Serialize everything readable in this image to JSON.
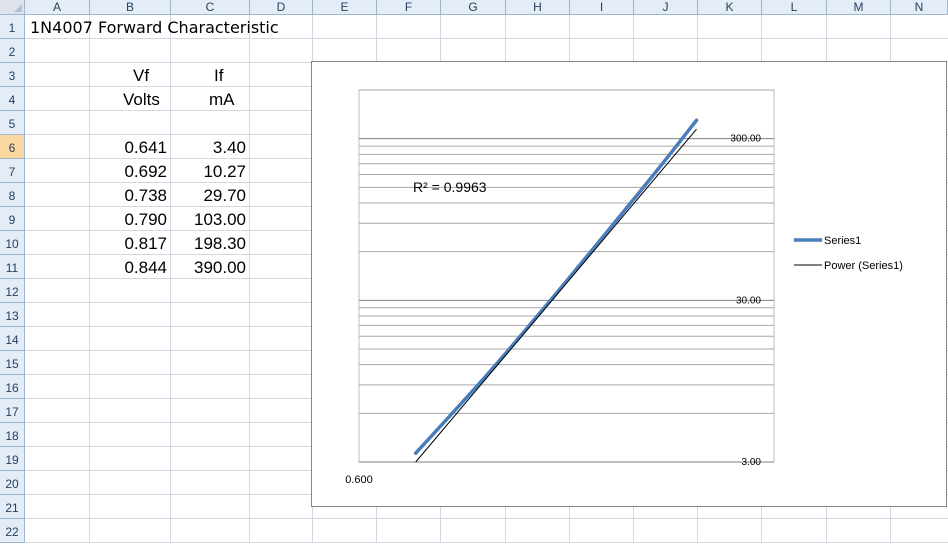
{
  "columns": [
    "A",
    "B",
    "C",
    "D",
    "E",
    "F",
    "G",
    "H",
    "I",
    "J",
    "K",
    "L",
    "M",
    "N"
  ],
  "rows": [
    "1",
    "2",
    "3",
    "4",
    "5",
    "6",
    "7",
    "8",
    "9",
    "10",
    "11",
    "12",
    "13",
    "14",
    "15",
    "16",
    "17",
    "18",
    "19",
    "20",
    "21",
    "22"
  ],
  "active_row": "6",
  "cells": {
    "A1": "1N4007 Forward Characteristic",
    "B3": "Vf",
    "C3": "If",
    "B4": "Volts",
    "C4": "mA",
    "B6": "0.641",
    "C6": "3.40",
    "B7": "0.692",
    "C7": "10.27",
    "B8": "0.738",
    "C8": "29.70",
    "B9": "0.790",
    "C9": "103.00",
    "B10": "0.817",
    "C10": "198.30",
    "B11": "0.844",
    "C11": "390.00"
  },
  "chart_data": {
    "type": "scatter",
    "y_scale": "log",
    "x_tick_labels": [
      "0.600"
    ],
    "y_tick_labels": [
      "3.00",
      "30.00",
      "300.00"
    ],
    "ylim": [
      3,
      600
    ],
    "xlim": [
      0.6,
      0.9
    ],
    "grid": true,
    "legend_position": "right",
    "series": [
      {
        "name": "Series1",
        "color": "#4a7ebb",
        "x": [
          0.641,
          0.692,
          0.738,
          0.79,
          0.817,
          0.844
        ],
        "y": [
          3.4,
          10.27,
          29.7,
          103.0,
          198.3,
          390.0
        ]
      },
      {
        "name": "Power (Series1)",
        "color": "#000000",
        "trendline": true
      }
    ],
    "annotation": "R² = 0.9963"
  }
}
